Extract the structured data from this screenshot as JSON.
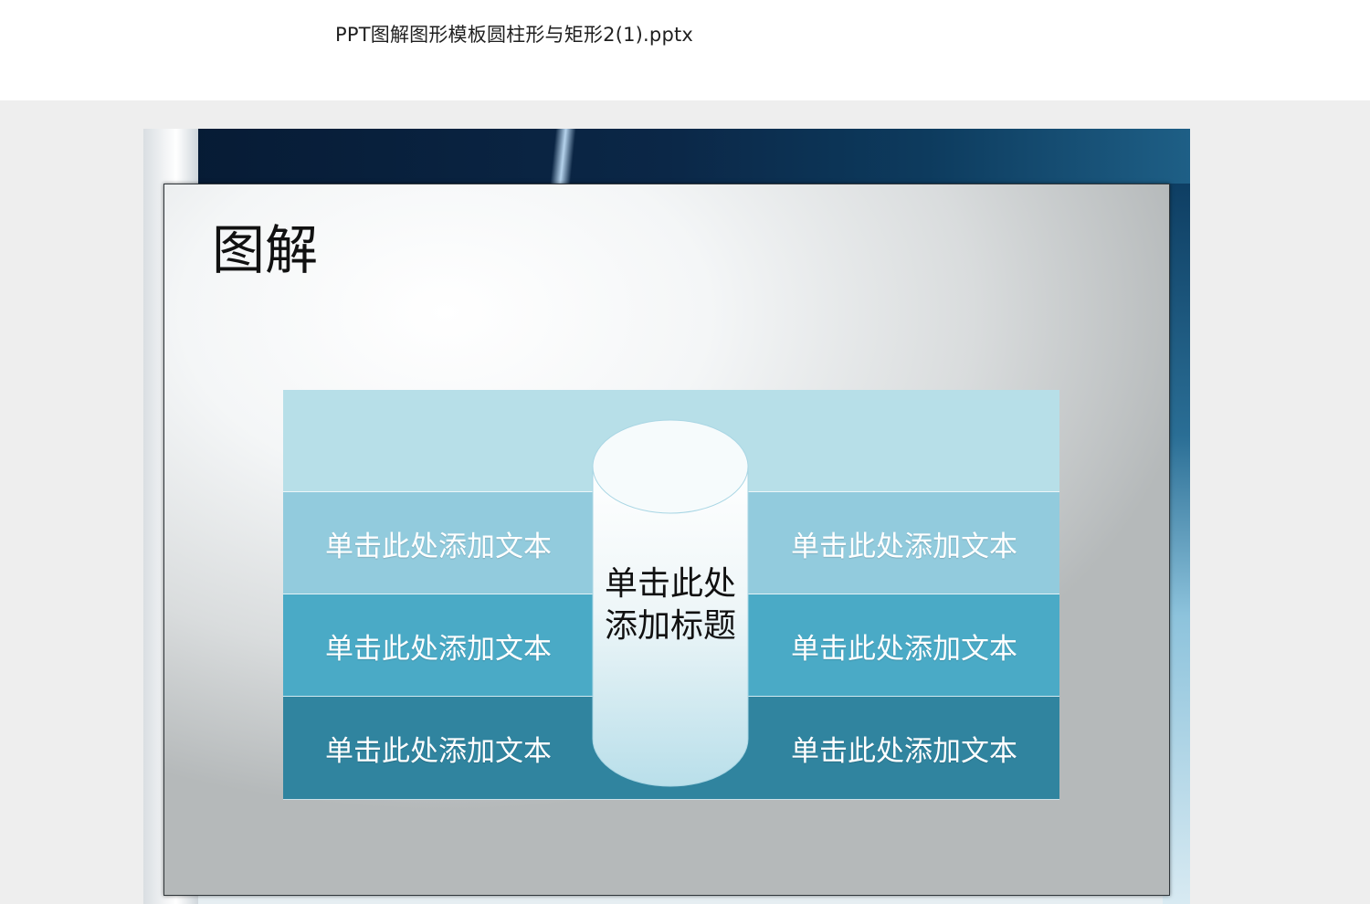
{
  "window": {
    "file_title": "PPT图解图形模板圆柱形与矩形2(1).pptx"
  },
  "slide": {
    "title": "图解",
    "cylinder": {
      "line1": "单击此处",
      "line2": "添加标题"
    },
    "rows": [
      {
        "left": "",
        "right": ""
      },
      {
        "left": "单击此处添加文本",
        "right": "单击此处添加文本"
      },
      {
        "left": "单击此处添加文本",
        "right": "单击此处添加文本"
      },
      {
        "left": "单击此处添加文本",
        "right": "单击此处添加文本"
      }
    ]
  },
  "colors": {
    "band_top": "#b7dfe8",
    "band_light": "#92cbdd",
    "band_mid": "#4aaac6",
    "band_dark": "#30849f"
  }
}
